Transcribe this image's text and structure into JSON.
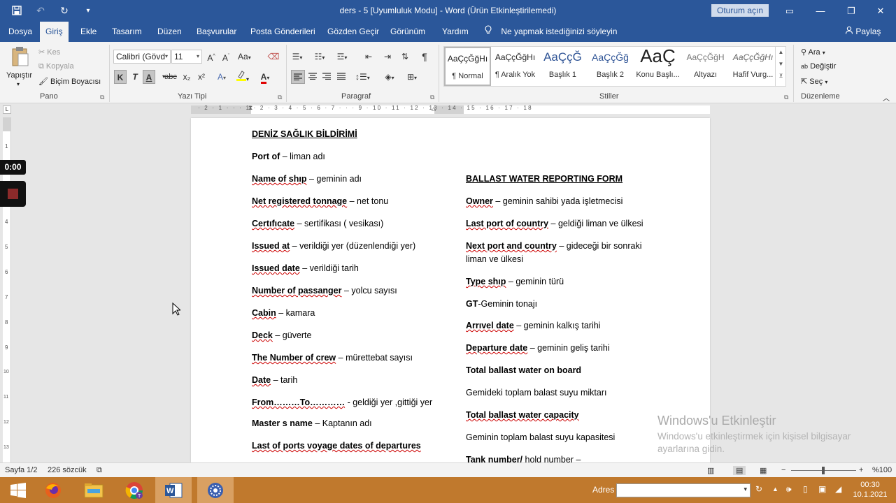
{
  "window": {
    "title": "ders - 5 [Uyumluluk Modu]  -  Word (Ürün Etkinleştirilemedi)",
    "signin": "Oturum açın"
  },
  "tabs": [
    {
      "label": "Dosya"
    },
    {
      "label": "Giriş"
    },
    {
      "label": "Ekle"
    },
    {
      "label": "Tasarım"
    },
    {
      "label": "Düzen"
    },
    {
      "label": "Başvurular"
    },
    {
      "label": "Posta Gönderileri"
    },
    {
      "label": "Gözden Geçir"
    },
    {
      "label": "Görünüm"
    },
    {
      "label": "Yardım"
    }
  ],
  "tellme": "Ne yapmak istediğinizi söyleyin",
  "share": "Paylaş",
  "clipboard": {
    "paste": "Yapıştır",
    "cut": "Kes",
    "copy": "Kopyala",
    "format_painter": "Biçim Boyacısı",
    "label": "Pano"
  },
  "font": {
    "name": "Calibri (Gövd",
    "size": "11",
    "label": "Yazı Tipi",
    "bold": "K",
    "italic": "T",
    "underline": "A",
    "strike": "abc",
    "sub": "x₂",
    "sup": "x²",
    "grow": "A^",
    "shrink": "Aˇ",
    "case": "Aa"
  },
  "paragraph": {
    "label": "Paragraf"
  },
  "styles": {
    "label": "Stiller",
    "items": [
      {
        "sample": "AaÇçĞğHı",
        "name": "¶ Normal"
      },
      {
        "sample": "AaÇçĞğHı",
        "name": "¶ Aralık Yok"
      },
      {
        "sample": "AaÇçĞ",
        "name": "Başlık 1"
      },
      {
        "sample": "AaÇçĞğ",
        "name": "Başlık 2"
      },
      {
        "sample": "AaÇ",
        "name": "Konu Başlı..."
      },
      {
        "sample": "AaÇçĞğH",
        "name": "Altyazı"
      },
      {
        "sample": "AaÇçĞğHı",
        "name": "Hafif Vurg..."
      }
    ]
  },
  "editing": {
    "find": "Ara",
    "replace": "Değiştir",
    "select": "Seç",
    "label": "Düzenleme"
  },
  "ruler": {
    "h_numbers": "· 2 · 1 · · · 1 · 2 · 3 · 4 · 5 · 6 · 7 · · · 9 · 10 · 11 · 12 · 13 · 14 · 15 · 16 · 17 · 18",
    "v_numbers": [
      "1",
      "2",
      "3",
      "4",
      "5",
      "6",
      "7",
      "8",
      "9",
      "10",
      "11",
      "12",
      "13"
    ],
    "tab_selector": "L"
  },
  "document": {
    "left": [
      {
        "bold": "DENİZ SAĞLIK BİLDİRİMİ",
        "rest": ""
      },
      {
        "bold": "Port of",
        "rest": " – liman adı"
      },
      {
        "bold": "Name of shıp",
        "rest": " – geminin adı"
      },
      {
        "bold": "Net registered tonnage",
        "rest": " – net tonu"
      },
      {
        "bold": "Certıfıcate",
        "rest": " – sertifikası ( vesikası)"
      },
      {
        "bold": "Issued at",
        "rest": " – verildiği yer (düzenlendiği yer)"
      },
      {
        "bold": "Issued date",
        "rest": " – verildiği tarih"
      },
      {
        "bold": "Number of passanger",
        "rest": " – yolcu sayısı"
      },
      {
        "bold": "Cabin",
        "rest": " – kamara"
      },
      {
        "bold": "Deck",
        "rest": " – güverte"
      },
      {
        "bold": "The Number of crew",
        "rest": " – mürettebat sayısı"
      },
      {
        "bold": "Date",
        "rest": " – tarih"
      },
      {
        "bold": "From………To…………",
        "rest": " - geldiği yer ,gittiği yer"
      },
      {
        "bold": "Master s name",
        "rest": " – Kaptanın adı"
      },
      {
        "bold": "Last of ports voyage dates of departures",
        "rest": ""
      }
    ],
    "right": [
      {
        "bold": "BALLAST WATER REPORTING FORM",
        "rest": ""
      },
      {
        "bold": "Owner",
        "rest": " – geminin sahibi yada işletmecisi"
      },
      {
        "bold": "Last port of country",
        "rest": " – geldiği liman ve ülkesi"
      },
      {
        "bold": "Next port and country",
        "rest": " – gideceği bir sonraki"
      },
      {
        "bold": "",
        "rest": "liman ve ülkesi"
      },
      {
        "bold": "Type shıp",
        "rest": " – geminin türü"
      },
      {
        "bold": "GT",
        "rest": "-Geminin tonajı"
      },
      {
        "bold": "Arrıvel date",
        "rest": " – geminin kalkış tarihi"
      },
      {
        "bold": "Departure date",
        "rest": " – geminin geliş tarihi"
      },
      {
        "bold": "Total ballast water on board",
        "rest": ""
      },
      {
        "bold": "",
        "rest": "Gemideki toplam balast suyu miktarı"
      },
      {
        "bold": "Total ballast  water capacity",
        "rest": ""
      },
      {
        "bold": "",
        "rest": "Geminin toplam balast suyu kapasitesi"
      },
      {
        "bold": "Tank number/",
        "rest": " hold number –"
      }
    ]
  },
  "watermark": {
    "title": "Windows'u Etkinleştir",
    "subtitle": "Windows'u etkinleştirmek için kişisel bilgisayar ayarlarına gidin."
  },
  "recorder": {
    "time": "0:00"
  },
  "status": {
    "page": "Sayfa 1/2",
    "words": "226 sözcük",
    "zoom": "%100"
  },
  "taskbar": {
    "address_label": "Adres",
    "time": "00:30",
    "date": "10.1.2021"
  }
}
